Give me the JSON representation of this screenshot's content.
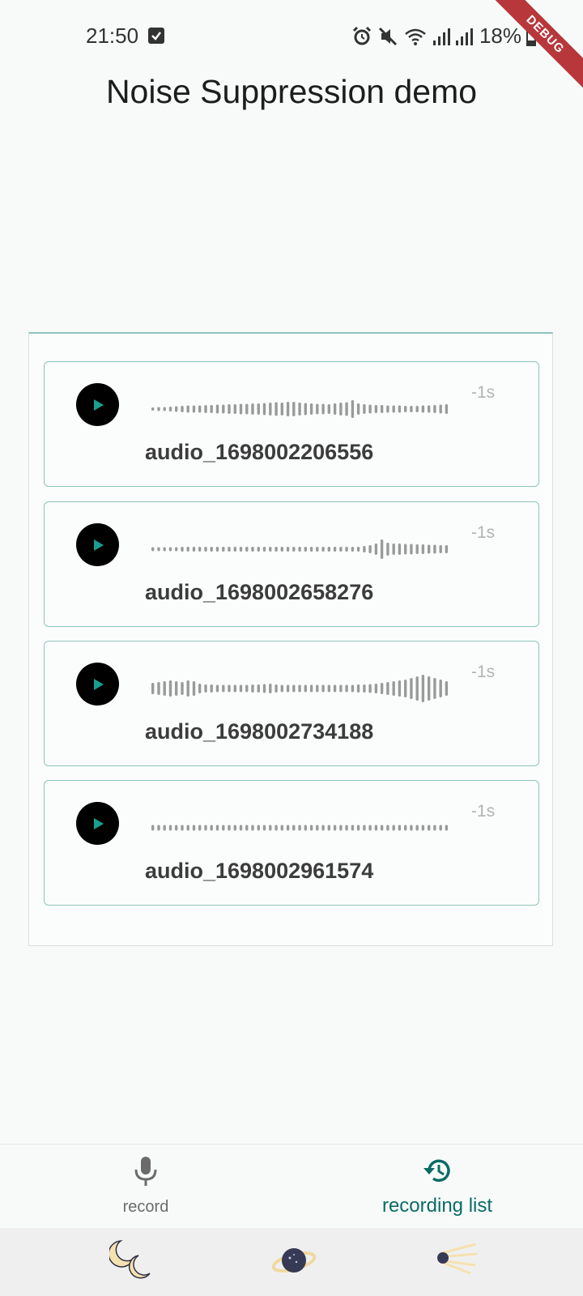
{
  "status_bar": {
    "time": "21:50",
    "battery": "18%",
    "icons": [
      "task-check-icon",
      "alarm-icon",
      "mute-icon",
      "wifi-icon",
      "signal-icon",
      "signal-icon",
      "battery-icon"
    ]
  },
  "debug_banner": "DEBUG",
  "app": {
    "title": "Noise Suppression demo"
  },
  "recordings": [
    {
      "name": "audio_1698002206556",
      "duration": "-1s",
      "play_icon": "play-icon"
    },
    {
      "name": "audio_1698002658276",
      "duration": "-1s",
      "play_icon": "play-icon"
    },
    {
      "name": "audio_1698002734188",
      "duration": "-1s",
      "play_icon": "play-icon"
    },
    {
      "name": "audio_1698002961574",
      "duration": "-1s",
      "play_icon": "play-icon"
    }
  ],
  "bottom_nav": {
    "record_label": "record",
    "record_icon": "microphone-icon",
    "list_label": "recording list",
    "list_icon": "history-icon",
    "active": "recording list"
  },
  "system_nav": {
    "buttons": [
      "moon-icon",
      "planet-icon",
      "comet-icon"
    ]
  },
  "colors": {
    "accent": "#0b6b66",
    "card_border": "#8fc4bd",
    "play_triangle": "#1a9e8f",
    "waveform": "#9a9a9a",
    "debug": "#b7373b"
  }
}
